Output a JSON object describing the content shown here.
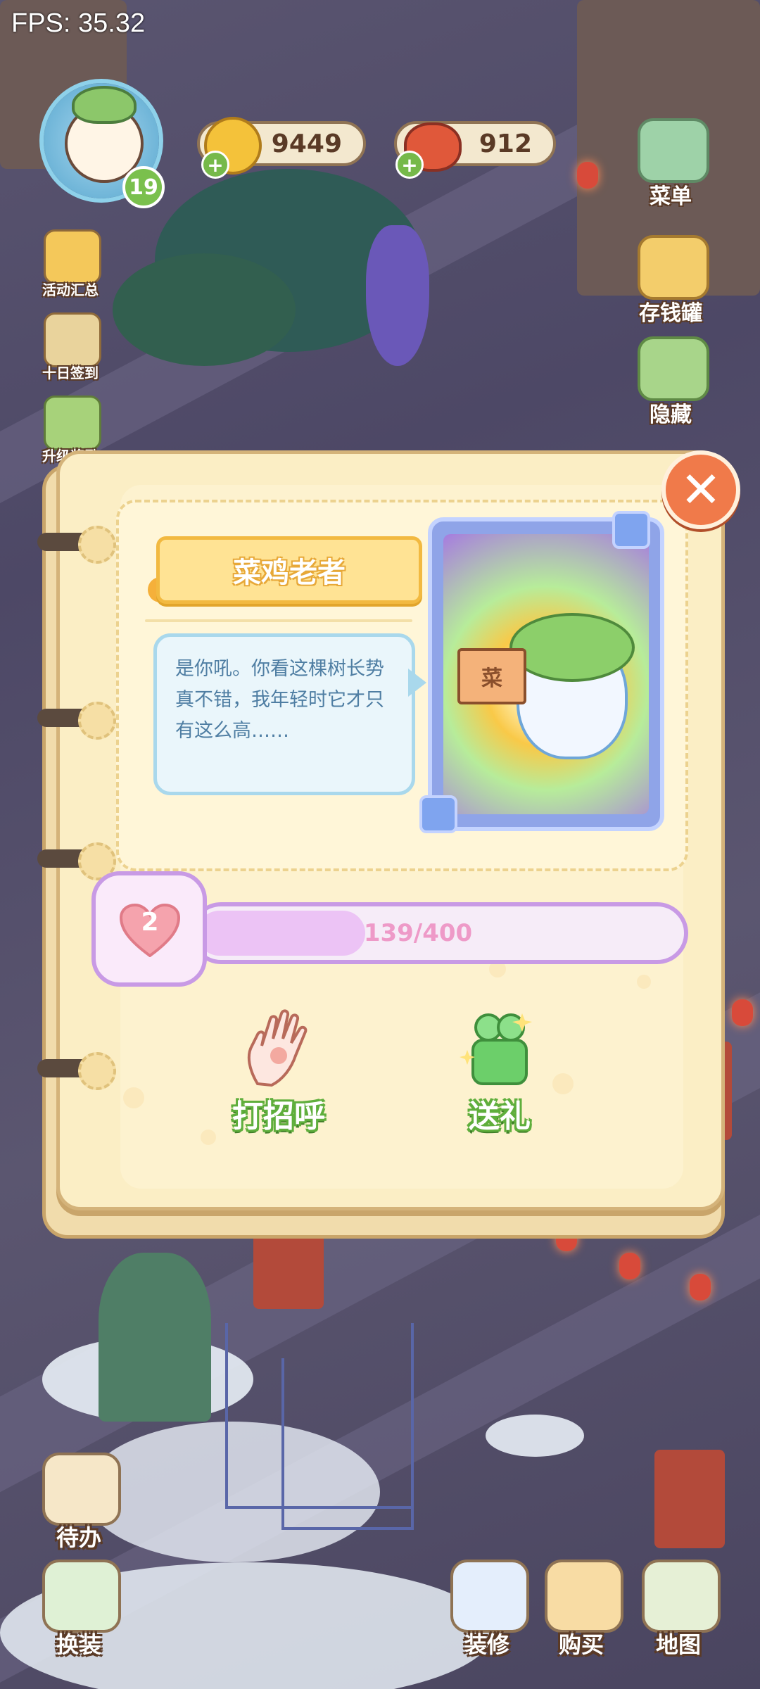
{
  "fps": "FPS: 35.32",
  "player": {
    "level": "19"
  },
  "currency": {
    "coins": "9449",
    "tomatoes": "912"
  },
  "left_menu": [
    {
      "label": "活动汇总",
      "icon": "event-icon"
    },
    {
      "label": "十日签到",
      "icon": "checkin-icon"
    },
    {
      "label": "升级奖励",
      "icon": "levelup-reward-icon"
    }
  ],
  "right_menu": [
    {
      "label": "菜单",
      "icon": "menu-icon"
    },
    {
      "label": "存钱罐",
      "icon": "piggy-bank-icon"
    },
    {
      "label": "隐藏",
      "icon": "hide-icon"
    }
  ],
  "dialog": {
    "npc_name": "菜鸡老者",
    "speech": "是你吼。你看这棵树长势真不错，我年轻时它才只有这么高……",
    "book_label": "菜",
    "affection": {
      "level": "2",
      "progress_text": "139/400",
      "current": 139,
      "max": 400
    },
    "actions": [
      {
        "label": "打招呼",
        "icon": "wave-hand-icon"
      },
      {
        "label": "送礼",
        "icon": "gift-icon"
      }
    ],
    "close_icon": "close-icon"
  },
  "bottom_left": [
    {
      "label": "待办",
      "icon": "todo-icon"
    },
    {
      "label": "换装",
      "icon": "dressup-icon"
    }
  ],
  "bottom_right": [
    {
      "label": "装修",
      "icon": "decorate-icon"
    },
    {
      "label": "购买",
      "icon": "shop-icon"
    },
    {
      "label": "地图",
      "icon": "map-icon"
    }
  ],
  "colors": {
    "accent": "#f07a4a",
    "affection": "#c89ae5",
    "action_green": "#5fae3c"
  }
}
